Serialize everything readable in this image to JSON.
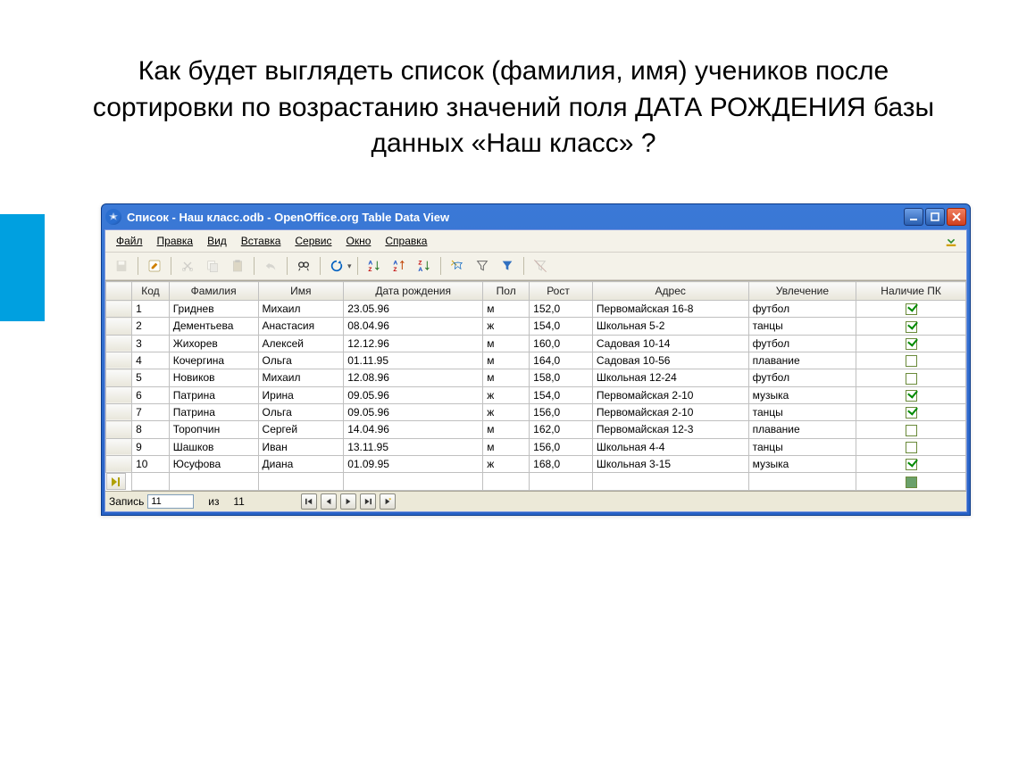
{
  "question": "Как будет выглядеть список (фамилия, имя) учеников после сортировки по возрастанию значений поля ДАТА РОЖДЕНИЯ базы данных «Наш класс» ?",
  "window": {
    "title": "Список - Наш класс.odb - OpenOffice.org Table Data View"
  },
  "menu": {
    "file": "Файл",
    "edit": "Правка",
    "view": "Вид",
    "insert": "Вставка",
    "tools": "Сервис",
    "window": "Окно",
    "help": "Справка"
  },
  "columns": {
    "code": "Код",
    "surname": "Фамилия",
    "name": "Имя",
    "dob": "Дата рождения",
    "sex": "Пол",
    "height": "Рост",
    "addr": "Адрес",
    "hobby": "Увлечение",
    "pc": "Наличие ПК"
  },
  "rows": [
    {
      "code": "1",
      "surname": "Гриднев",
      "name": "Михаил",
      "dob": "23.05.96",
      "sex": "м",
      "height": "152,0",
      "addr": "Первомайская 16-8",
      "hobby": "футбол",
      "pc": true
    },
    {
      "code": "2",
      "surname": "Дементьева",
      "name": "Анастасия",
      "dob": "08.04.96",
      "sex": "ж",
      "height": "154,0",
      "addr": "Школьная 5-2",
      "hobby": "танцы",
      "pc": true
    },
    {
      "code": "3",
      "surname": "Жихорев",
      "name": "Алексей",
      "dob": "12.12.96",
      "sex": "м",
      "height": "160,0",
      "addr": "Садовая 10-14",
      "hobby": "футбол",
      "pc": true
    },
    {
      "code": "4",
      "surname": "Кочергина",
      "name": "Ольга",
      "dob": "01.11.95",
      "sex": "м",
      "height": "164,0",
      "addr": "Садовая 10-56",
      "hobby": "плавание",
      "pc": false
    },
    {
      "code": "5",
      "surname": "Новиков",
      "name": "Михаил",
      "dob": "12.08.96",
      "sex": "м",
      "height": "158,0",
      "addr": "Школьная 12-24",
      "hobby": "футбол",
      "pc": false
    },
    {
      "code": "6",
      "surname": "Патрина",
      "name": "Ирина",
      "dob": "09.05.96",
      "sex": "ж",
      "height": "154,0",
      "addr": "Первомайская 2-10",
      "hobby": "музыка",
      "pc": true
    },
    {
      "code": "7",
      "surname": "Патрина",
      "name": "Ольга",
      "dob": "09.05.96",
      "sex": "ж",
      "height": "156,0",
      "addr": "Первомайская 2-10",
      "hobby": "танцы",
      "pc": true
    },
    {
      "code": "8",
      "surname": "Торопчин",
      "name": "Сергей",
      "dob": "14.04.96",
      "sex": "м",
      "height": "162,0",
      "addr": "Первомайская 12-3",
      "hobby": "плавание",
      "pc": false
    },
    {
      "code": "9",
      "surname": "Шашков",
      "name": "Иван",
      "dob": "13.11.95",
      "sex": "м",
      "height": "156,0",
      "addr": "Школьная 4-4",
      "hobby": "танцы",
      "pc": false
    },
    {
      "code": "10",
      "surname": "Юсуфова",
      "name": "Диана",
      "dob": "01.09.95",
      "sex": "ж",
      "height": "168,0",
      "addr": "Школьная 3-15",
      "hobby": "музыка",
      "pc": true
    }
  ],
  "recordnav": {
    "label": "Запись",
    "current": "11",
    "of": "из",
    "total": "11"
  }
}
